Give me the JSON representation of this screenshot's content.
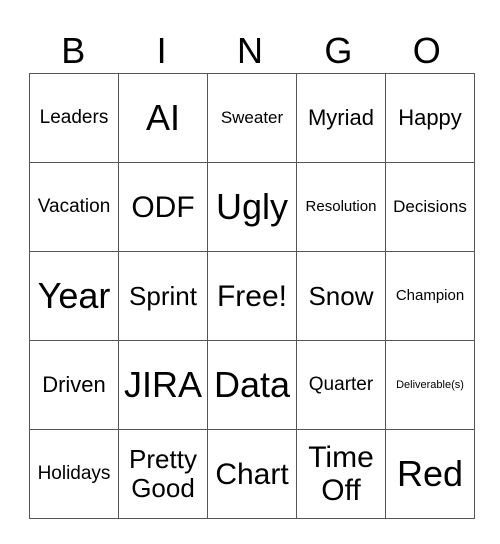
{
  "header": [
    "B",
    "I",
    "N",
    "G",
    "O"
  ],
  "rows": [
    [
      "Leaders",
      "AI",
      "Sweater",
      "Myriad",
      "Happy"
    ],
    [
      "Vacation",
      "ODF",
      "Ugly",
      "Resolution",
      "Decisions"
    ],
    [
      "Year",
      "Sprint",
      "Free!",
      "Snow",
      "Champion"
    ],
    [
      "Driven",
      "JIRA",
      "Data",
      "Quarter",
      "Deliverable(s)"
    ],
    [
      "Holidays",
      "Pretty Good",
      "Chart",
      "Time Off",
      "Red"
    ]
  ]
}
